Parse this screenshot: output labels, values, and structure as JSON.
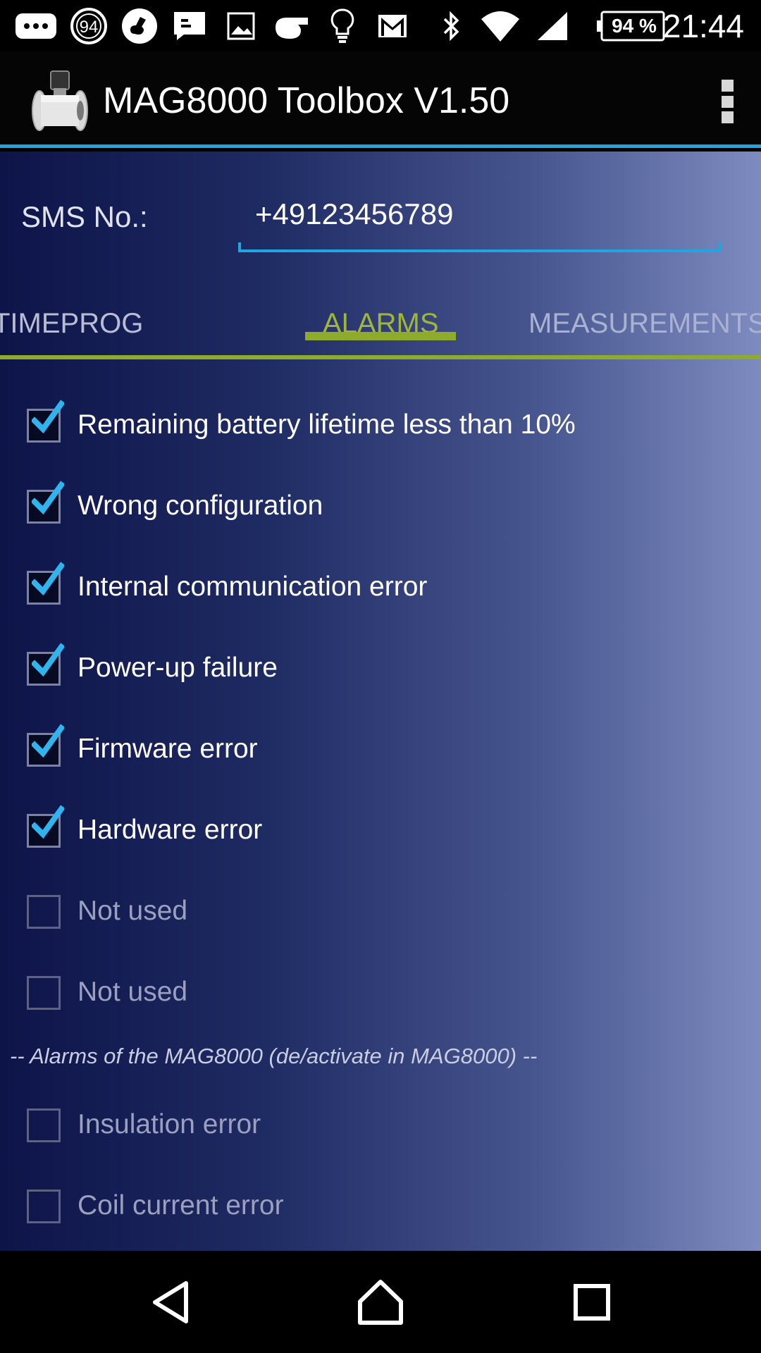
{
  "status_bar": {
    "badge_number": "94",
    "battery_percent": "94 %",
    "time": "21:44",
    "icons": [
      "chat-icon",
      "badge-94-icon",
      "music-app-icon",
      "message-icon",
      "image-icon",
      "whistle-icon",
      "bulb-icon",
      "gmail-icon",
      "bluetooth-icon",
      "wifi-icon",
      "signal-icon",
      "battery-icon"
    ]
  },
  "app_bar": {
    "title": "MAG8000 Toolbox V1.50",
    "logo_icon": "flowmeter-logo-icon",
    "menu_icon": "overflow-menu-icon"
  },
  "sms": {
    "label": "SMS No.:",
    "value": "+49123456789"
  },
  "tabs": [
    {
      "label": "TIMEPROG",
      "active": false
    },
    {
      "label": "ALARMS",
      "active": true
    },
    {
      "label": "MEASUREMENTS",
      "active": false
    }
  ],
  "alarms": [
    {
      "label": "Remaining battery lifetime less than 10%",
      "checked": true
    },
    {
      "label": "Wrong configuration",
      "checked": true
    },
    {
      "label": "Internal communication error",
      "checked": true
    },
    {
      "label": "Power-up failure",
      "checked": true
    },
    {
      "label": "Firmware error",
      "checked": true
    },
    {
      "label": "Hardware error",
      "checked": true
    },
    {
      "label": "Not used",
      "checked": false
    },
    {
      "label": "Not used",
      "checked": false
    }
  ],
  "device_alarms_note": "-- Alarms of the MAG8000 (de/activate in MAG8000) --",
  "device_alarms": [
    {
      "label": "Insulation error",
      "checked": false
    },
    {
      "label": "Coil current error",
      "checked": false
    }
  ],
  "colors": {
    "accent_blue": "#21a5e0",
    "accent_green": "#8fab2c",
    "tab_active_text": "#9fb637"
  },
  "nav_bar": {
    "icons": [
      "back-icon",
      "home-icon",
      "recents-icon"
    ]
  }
}
